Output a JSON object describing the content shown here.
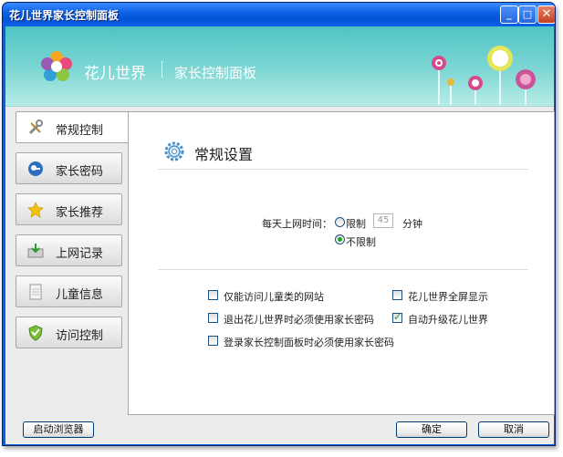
{
  "window": {
    "title": "花儿世界家长控制面板"
  },
  "titlebar_buttons": {
    "minimize": "_",
    "maximize": "□",
    "close": "✕"
  },
  "banner": {
    "brand": "花儿世界",
    "subtitle": "家长控制面板"
  },
  "sidebar": {
    "items": [
      {
        "label": "常规控制",
        "icon": "tools-icon",
        "active": true
      },
      {
        "label": "家长密码",
        "icon": "key-icon",
        "active": false
      },
      {
        "label": "家长推荐",
        "icon": "star-icon",
        "active": false
      },
      {
        "label": "上网记录",
        "icon": "inbox-icon",
        "active": false
      },
      {
        "label": "儿童信息",
        "icon": "document-icon",
        "active": false
      },
      {
        "label": "访问控制",
        "icon": "shield-icon",
        "active": false
      }
    ]
  },
  "section": {
    "title": "常规设置",
    "time_label": "每天上网时间：",
    "radio_limit": "限制",
    "radio_unlimited": "不限制",
    "minutes_value": "45",
    "minutes_unit": "分钟",
    "selected_radio": "不限制"
  },
  "options": [
    {
      "label": "仅能访问儿童类的网站",
      "checked": false
    },
    {
      "label": "花儿世界全屏显示",
      "checked": false
    },
    {
      "label": "退出花儿世界时必须使用家长密码",
      "checked": false
    },
    {
      "label": "自动升级花儿世界",
      "checked": true
    },
    {
      "label": "登录家长控制面板时必须使用家长密码",
      "checked": false
    }
  ],
  "footer": {
    "browser_button": "启动浏览器",
    "ok_button": "确定",
    "cancel_button": "取消"
  },
  "colors": {
    "accent": "#21a121",
    "titlebar": "#0a5fe3",
    "banner": "#4fc4c4"
  }
}
